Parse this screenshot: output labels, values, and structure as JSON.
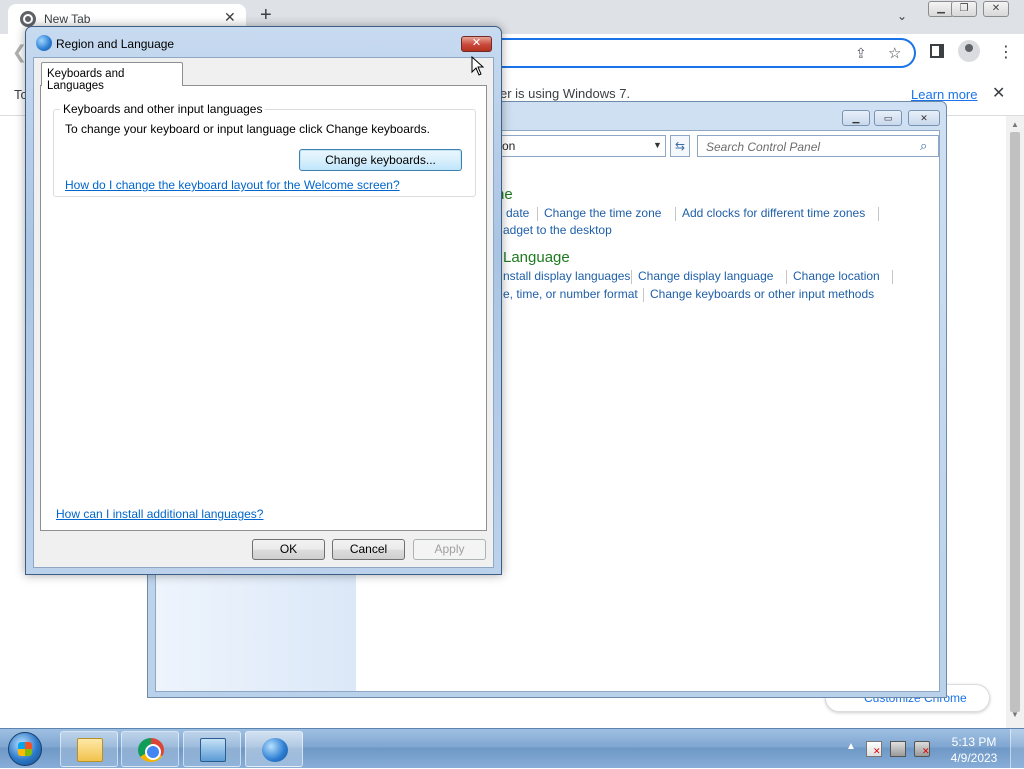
{
  "chrome": {
    "tab_title": "New Tab",
    "tab_close": "✕",
    "new_tab": "+",
    "tab_search": "⌄",
    "infobar_left": "To",
    "infobar_message": "er is using Windows 7.",
    "learn_more": "Learn more",
    "infobar_close": "✕",
    "customize": "Customize Chrome"
  },
  "control_panel": {
    "address_text": "on",
    "search_placeholder": "Search Control Panel",
    "heading_clock": "ne",
    "clock_links": [
      "date",
      "Change the time zone",
      "Add clocks for different time zones",
      "adget to the desktop"
    ],
    "heading_language": "Language",
    "language_links": [
      "nstall display languages",
      "Change display language",
      "Change location",
      "e, time, or number format",
      "Change keyboards or other input methods"
    ]
  },
  "dialog": {
    "title": "Region and Language",
    "close": "✕",
    "tab": "Keyboards and Languages",
    "group_label": "Keyboards and other input languages",
    "group_text": "To change your keyboard or input language click Change keyboards.",
    "change_keyboards": "Change keyboards...",
    "welcome_link": "How do I change the keyboard layout for the Welcome screen?",
    "install_link": "How can I install additional languages?",
    "ok": "OK",
    "cancel": "Cancel",
    "apply": "Apply"
  },
  "taskbar": {
    "time": "5:13 PM",
    "date": "4/9/2023"
  },
  "colors": {
    "link": "#1f5fa8",
    "heading_green": "#1e7b1e",
    "chrome_accent": "#1a73e8"
  }
}
